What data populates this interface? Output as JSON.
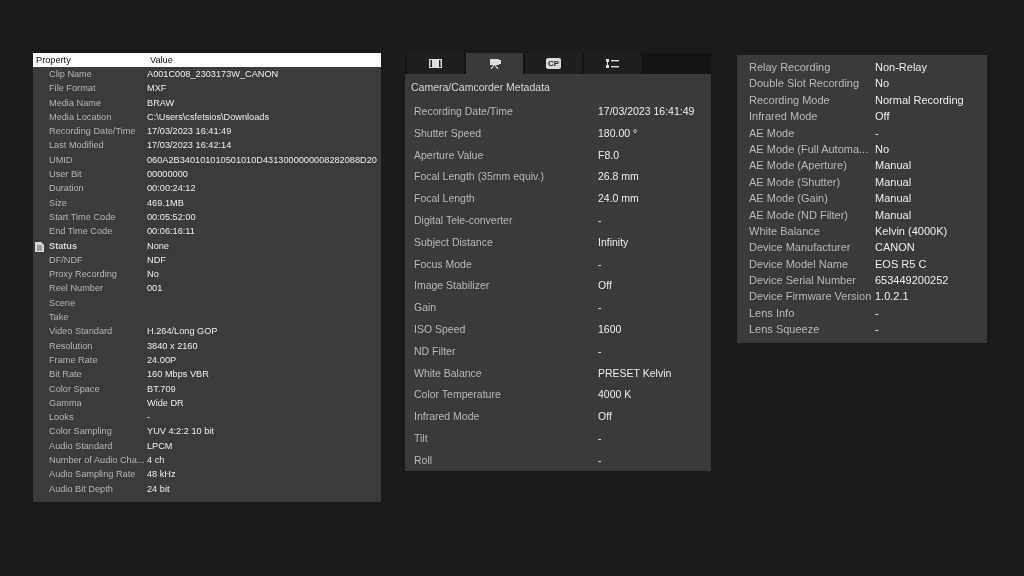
{
  "clip_properties": {
    "columns": [
      "Property",
      "Value"
    ],
    "rows": [
      {
        "kind": "item",
        "property": "Clip Name",
        "value": "A001C008_2303173W_CANON"
      },
      {
        "kind": "item",
        "property": "File Format",
        "value": "MXF"
      },
      {
        "kind": "item",
        "property": "Media Name",
        "value": "BRAW"
      },
      {
        "kind": "item",
        "property": "Media Location",
        "value": "C:\\Users\\csfetsios\\Downloads"
      },
      {
        "kind": "item",
        "property": "Recording Date/Time",
        "value": "17/03/2023 16:41:49"
      },
      {
        "kind": "item",
        "property": "Last Modified",
        "value": "17/03/2023 16:42:14"
      },
      {
        "kind": "item",
        "property": "UMID",
        "value": "060A2B340101010501010D4313000000008282088D20"
      },
      {
        "kind": "item",
        "property": "User Bit",
        "value": "00000000"
      },
      {
        "kind": "item",
        "property": "Duration",
        "value": "00:00:24:12"
      },
      {
        "kind": "item",
        "property": "Size",
        "value": "469.1MB"
      },
      {
        "kind": "item",
        "property": "Start Time Code",
        "value": "00:05:52:00"
      },
      {
        "kind": "item",
        "property": "End Time Code",
        "value": "00:06:16:11"
      },
      {
        "kind": "group",
        "property": "Status",
        "value": "None"
      },
      {
        "kind": "item",
        "property": "DF/NDF",
        "value": "NDF"
      },
      {
        "kind": "item",
        "property": "Proxy Recording",
        "value": "No"
      },
      {
        "kind": "item",
        "property": "Reel Number",
        "value": "001"
      },
      {
        "kind": "item",
        "property": "Scene"
      },
      {
        "kind": "item",
        "property": "Take"
      },
      {
        "kind": "item",
        "property": "Video Standard",
        "value": "H.264/Long GOP"
      },
      {
        "kind": "item",
        "property": "Resolution",
        "value": "3840 x 2160"
      },
      {
        "kind": "item",
        "property": "Frame Rate",
        "value": "24.00P"
      },
      {
        "kind": "item",
        "property": "Bit Rate",
        "value": "160 Mbps VBR"
      },
      {
        "kind": "item",
        "property": "Color Space",
        "value": "BT.709"
      },
      {
        "kind": "item",
        "property": "Gamma",
        "value": "Wide DR"
      },
      {
        "kind": "item",
        "property": "Looks",
        "value": "-"
      },
      {
        "kind": "item",
        "property": "Color Sampling",
        "value": "YUV 4:2:2 10 bit"
      },
      {
        "kind": "item",
        "property": "Audio Standard",
        "value": "LPCM"
      },
      {
        "kind": "item",
        "property": "Number of Audio Cha...",
        "value": "4 ch"
      },
      {
        "kind": "item",
        "property": "Audio Sampling Rate",
        "value": "48 kHz"
      },
      {
        "kind": "item",
        "property": "Audio Bit Depth",
        "value": "24 bit"
      }
    ]
  },
  "camera_panel": {
    "tabs": [
      {
        "kind": "film",
        "selected": false
      },
      {
        "kind": "camera",
        "selected": true
      },
      {
        "kind": "text",
        "label": "CP",
        "selected": false
      },
      {
        "kind": "list",
        "selected": false
      }
    ],
    "title": "Camera/Camcorder Metadata",
    "rows": [
      {
        "property": "Recording Date/Time",
        "value": "17/03/2023 16:41:49"
      },
      {
        "property": "Shutter Speed",
        "value": "180.00 °"
      },
      {
        "property": "Aperture Value",
        "value": "F8.0"
      },
      {
        "property": "Focal Length (35mm equiv.)",
        "value": "26.8 mm"
      },
      {
        "property": "Focal Length",
        "value": "24.0 mm"
      },
      {
        "property": "Digital Tele-converter",
        "value": "-"
      },
      {
        "property": "Subject Distance",
        "value": "Infinity"
      },
      {
        "property": "Focus Mode",
        "value": "-"
      },
      {
        "property": "Image Stabilizer",
        "value": "Off"
      },
      {
        "property": "Gain",
        "value": "-"
      },
      {
        "property": "ISO Speed",
        "value": "1600"
      },
      {
        "property": "ND Filter",
        "value": "-"
      },
      {
        "property": "White Balance",
        "value": "PRESET Kelvin"
      },
      {
        "property": "Color Temperature",
        "value": "4000 K"
      },
      {
        "property": "Infrared Mode",
        "value": "Off"
      },
      {
        "property": "Tilt",
        "value": "-"
      },
      {
        "property": "Roll",
        "value": "-"
      }
    ]
  },
  "device_panel": {
    "rows": [
      {
        "property": "Relay Recording",
        "value": "Non-Relay"
      },
      {
        "property": "Double Slot Recording",
        "value": "No"
      },
      {
        "property": "Recording Mode",
        "value": "Normal Recording"
      },
      {
        "property": "Infrared Mode",
        "value": "Off"
      },
      {
        "property": "AE Mode",
        "value": "-"
      },
      {
        "property": "AE Mode (Full Automa...",
        "value": "No"
      },
      {
        "property": "AE Mode (Aperture)",
        "value": "Manual"
      },
      {
        "property": "AE Mode (Shutter)",
        "value": "Manual"
      },
      {
        "property": "AE Mode (Gain)",
        "value": "Manual"
      },
      {
        "property": "AE Mode (ND Filter)",
        "value": "Manual"
      },
      {
        "property": "White Balance",
        "value": "Kelvin (4000K)"
      },
      {
        "property": "Device Manufacturer",
        "value": "CANON"
      },
      {
        "property": "Device Model Name",
        "value": "EOS R5 C"
      },
      {
        "property": "Device Serial Number",
        "value": "653449200252"
      },
      {
        "property": "Device Firmware Version",
        "value": "1.0.2.1"
      },
      {
        "property": "Lens Info",
        "value": "-"
      },
      {
        "property": "Lens Squeeze",
        "value": "-"
      }
    ]
  }
}
